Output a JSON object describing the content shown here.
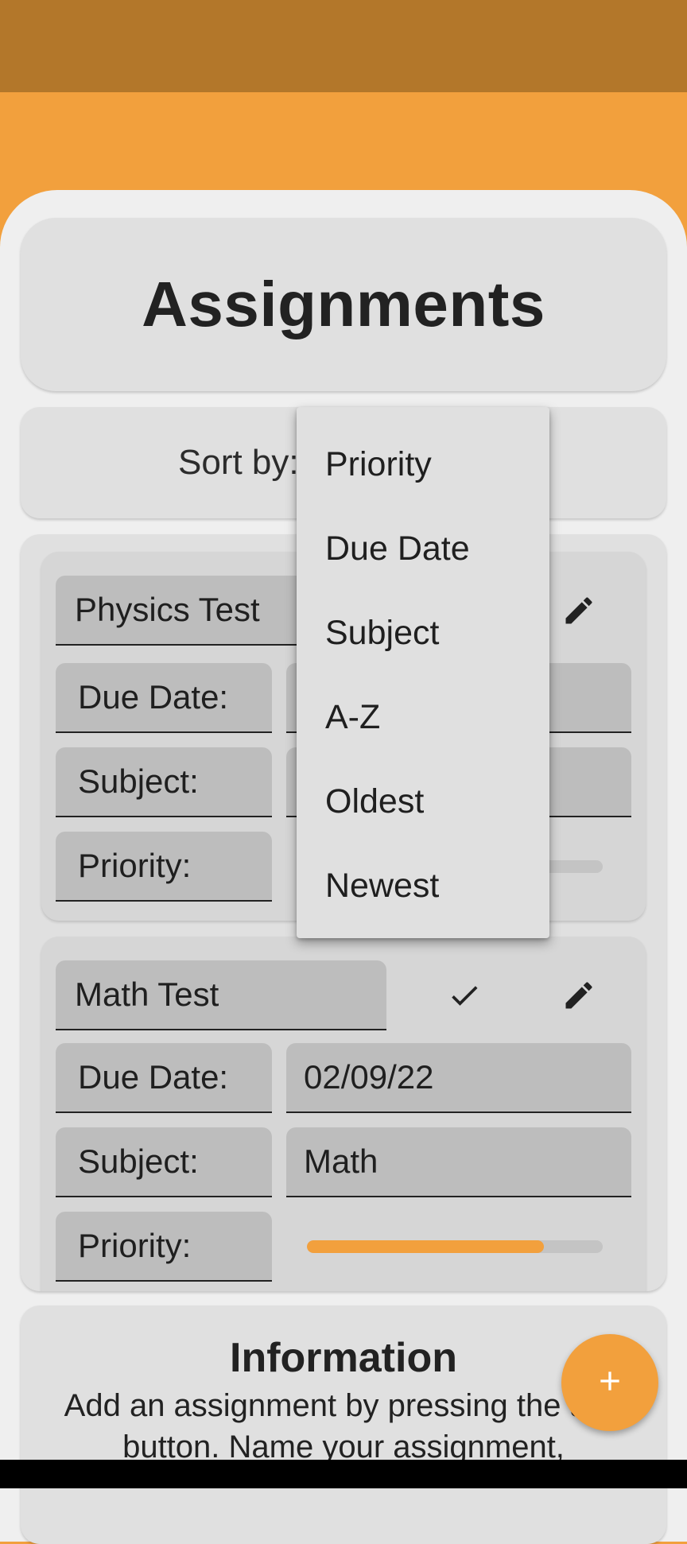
{
  "header": {
    "title": "Assignments"
  },
  "sort": {
    "label": "Sort by:",
    "options": [
      "Priority",
      "Due Date",
      "Subject",
      "A-Z",
      "Oldest",
      "Newest"
    ]
  },
  "labels": {
    "due_date": "Due Date:",
    "subject": "Subject:",
    "priority": "Priority:"
  },
  "assignments": [
    {
      "name": "Physics Test",
      "due_date": "",
      "subject": "",
      "priority_level": 0.8,
      "completed_icon": ""
    },
    {
      "name": "Math Test",
      "due_date": "02/09/22",
      "subject": "Math",
      "priority_level": 0.8,
      "completed_icon": "check-icon"
    }
  ],
  "info": {
    "title": "Information",
    "text": "Add an assignment by pressing the add button. Name your assignment,"
  },
  "fab": {
    "icon": "plus-icon"
  },
  "colors": {
    "accent": "#f2a03d",
    "status_bar": "#b3772a",
    "card": "#e0e0e0",
    "field": "#bdbdbd"
  }
}
